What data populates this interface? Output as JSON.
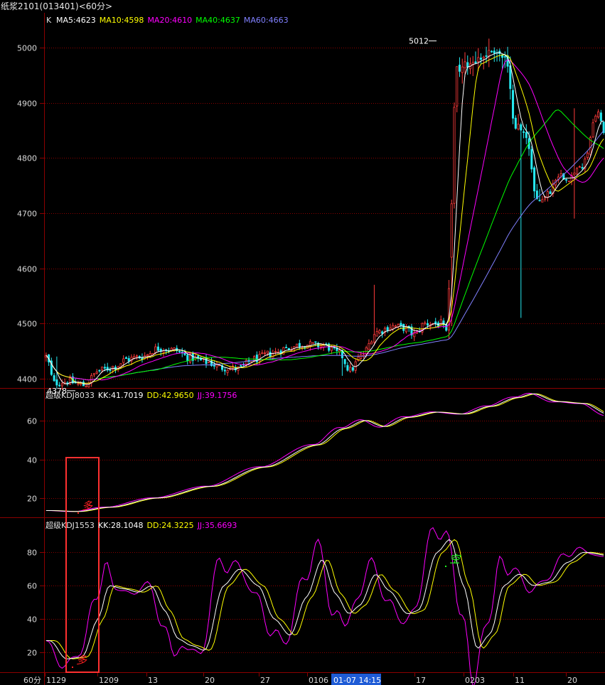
{
  "window": {
    "title": "纸浆2101(013401)<60分>"
  },
  "colors": {
    "up": "#ff3b3b",
    "down": "#26e8f0",
    "grid": "#8b0000",
    "ma5": "#ffffff",
    "ma10": "#ffff00",
    "ma20": "#ff00ff",
    "ma40": "#00ff00",
    "ma60": "#8080ff",
    "kk": "#ffffff",
    "dd": "#ffff00",
    "jj": "#ff00ff",
    "signal_buy": "#ff2020",
    "signal_sell": "#20ff20",
    "highlight": "#ff3030"
  },
  "main_panel": {
    "indicator_label": "K",
    "legend": [
      {
        "key": "ma5",
        "text": "MA5:4623"
      },
      {
        "key": "ma10",
        "text": "MA10:4598"
      },
      {
        "key": "ma20",
        "text": "MA20:4610"
      },
      {
        "key": "ma40",
        "text": "MA40:4637"
      },
      {
        "key": "ma60",
        "text": "MA60:4663"
      }
    ],
    "y_ticks": [
      4400,
      4500,
      4600,
      4700,
      4800,
      4900,
      5000
    ],
    "ylim": [
      4383,
      5063
    ],
    "high_annotation": {
      "text": "5012",
      "value": 5012
    },
    "low_annotation": {
      "text": "4378",
      "value": 4378
    }
  },
  "kdj1_panel": {
    "legend": [
      {
        "key": "name",
        "text": "超级KDJ8033"
      },
      {
        "key": "kk",
        "text": "KK:41.7019"
      },
      {
        "key": "dd",
        "text": "DD:42.9650"
      },
      {
        "key": "jj",
        "text": "JJ:39.1756"
      }
    ],
    "y_ticks": [
      20,
      40,
      60
    ],
    "ylim": [
      10.0,
      77.0
    ],
    "buy_signal_label": "多"
  },
  "kdj2_panel": {
    "legend": [
      {
        "key": "name",
        "text": "超级KDJ1553"
      },
      {
        "key": "kk",
        "text": "KK:28.1048"
      },
      {
        "key": "dd",
        "text": "DD:24.3225"
      },
      {
        "key": "jj",
        "text": "JJ:35.6693"
      }
    ],
    "y_ticks": [
      20,
      40,
      60,
      80
    ],
    "ylim": [
      8.0,
      101.0
    ],
    "buy_signal_label": "多",
    "sell_signal_label": "空"
  },
  "x_axis": {
    "period_label": "60分",
    "labels": [
      "1129",
      "1209",
      "13",
      "20",
      "27",
      "0106",
      "01-07 14:15",
      "17",
      "0203",
      "11",
      "20"
    ],
    "cursor_label": "01-07 14:15"
  },
  "chart_data": {
    "type": "candlestick",
    "bar_count": 210,
    "price_anchors": [
      [
        0,
        4440
      ],
      [
        3,
        4392
      ],
      [
        8,
        4395
      ],
      [
        14,
        4388
      ],
      [
        20,
        4415
      ],
      [
        26,
        4422
      ],
      [
        30,
        4435
      ],
      [
        36,
        4440
      ],
      [
        42,
        4455
      ],
      [
        48,
        4452
      ],
      [
        54,
        4438
      ],
      [
        60,
        4430
      ],
      [
        66,
        4420
      ],
      [
        72,
        4418
      ],
      [
        78,
        4435
      ],
      [
        84,
        4445
      ],
      [
        90,
        4455
      ],
      [
        96,
        4462
      ],
      [
        104,
        4460
      ],
      [
        110,
        4445
      ],
      [
        114,
        4415
      ],
      [
        118,
        4440
      ],
      [
        124,
        4485
      ],
      [
        130,
        4495
      ],
      [
        134,
        4492
      ],
      [
        138,
        4480
      ],
      [
        142,
        4500
      ],
      [
        148,
        4500
      ],
      [
        150,
        4482
      ],
      [
        154,
        4960
      ],
      [
        158,
        4970
      ],
      [
        162,
        4980
      ],
      [
        168,
        4995
      ],
      [
        172,
        4980
      ],
      [
        176,
        4860
      ],
      [
        180,
        4840
      ],
      [
        184,
        4720
      ],
      [
        188,
        4735
      ],
      [
        192,
        4770
      ],
      [
        196,
        4765
      ],
      [
        200,
        4780
      ],
      [
        203,
        4810
      ],
      [
        205,
        4870
      ],
      [
        207,
        4880
      ],
      [
        209,
        4850
      ]
    ],
    "kdj1_anchors": [
      [
        0,
        13.5
      ],
      [
        10,
        13.0
      ],
      [
        22,
        15.2
      ],
      [
        40,
        20.0
      ],
      [
        60,
        26.0
      ],
      [
        80,
        36.0
      ],
      [
        100,
        47.5
      ],
      [
        110,
        56.0
      ],
      [
        118,
        60.2
      ],
      [
        125,
        57.0
      ],
      [
        134,
        61.8
      ],
      [
        145,
        64.5
      ],
      [
        155,
        63.5
      ],
      [
        165,
        67.5
      ],
      [
        175,
        72.0
      ],
      [
        181,
        74.0
      ],
      [
        190,
        70.0
      ],
      [
        200,
        69.0
      ],
      [
        210,
        63.0
      ]
    ],
    "kdj2_anchors": [
      [
        0,
        27
      ],
      [
        6,
        16
      ],
      [
        12,
        17
      ],
      [
        18,
        40
      ],
      [
        22,
        60
      ],
      [
        28,
        58
      ],
      [
        33,
        56
      ],
      [
        38,
        60
      ],
      [
        43,
        45
      ],
      [
        48,
        28
      ],
      [
        53,
        24
      ],
      [
        58,
        21
      ],
      [
        65,
        60
      ],
      [
        71,
        70
      ],
      [
        78,
        60
      ],
      [
        84,
        40
      ],
      [
        90,
        30
      ],
      [
        96,
        53
      ],
      [
        102,
        76
      ],
      [
        107,
        55
      ],
      [
        112,
        43
      ],
      [
        116,
        48
      ],
      [
        122,
        67
      ],
      [
        127,
        57
      ],
      [
        134,
        43
      ],
      [
        138,
        45
      ],
      [
        145,
        80
      ],
      [
        150,
        88
      ],
      [
        155,
        60
      ],
      [
        160,
        22
      ],
      [
        165,
        31
      ],
      [
        170,
        60
      ],
      [
        176,
        67
      ],
      [
        181,
        60
      ],
      [
        187,
        62
      ],
      [
        194,
        74
      ],
      [
        200,
        80
      ],
      [
        210,
        78
      ]
    ]
  }
}
